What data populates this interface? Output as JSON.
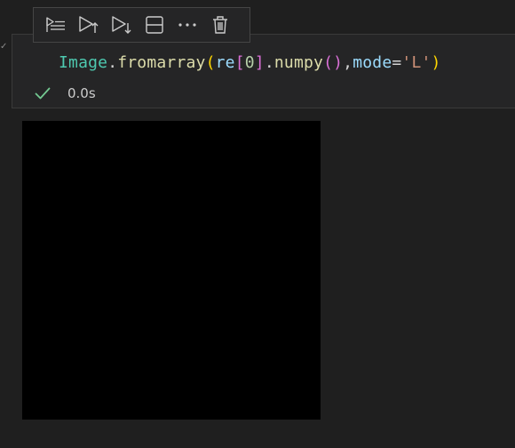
{
  "toolbar": {
    "buttons": [
      {
        "icon": "run-by-line-icon"
      },
      {
        "icon": "execute-above-icon"
      },
      {
        "icon": "execute-below-icon"
      },
      {
        "icon": "split-cell-icon"
      },
      {
        "icon": "more-actions-icon"
      },
      {
        "icon": "delete-cell-icon"
      }
    ]
  },
  "cell": {
    "code": {
      "class_name": "Image",
      "dot1": ".",
      "func": "fromarray",
      "paren_open": "(",
      "var": "re",
      "bracket_open": "[",
      "index": "0",
      "bracket_close": "]",
      "dot2": ".",
      "method": "numpy",
      "call_parens": "()",
      "comma": ",",
      "kwarg": "mode",
      "equals": "=",
      "string": "'L'",
      "paren_close": ")"
    },
    "status": {
      "icon": "check-icon",
      "time": "0.0s"
    },
    "left_marker": "✓"
  },
  "colors": {
    "background": "#1f1f1f",
    "cell_background": "#252526",
    "check_green": "#73c991",
    "output_image": "#000000"
  }
}
